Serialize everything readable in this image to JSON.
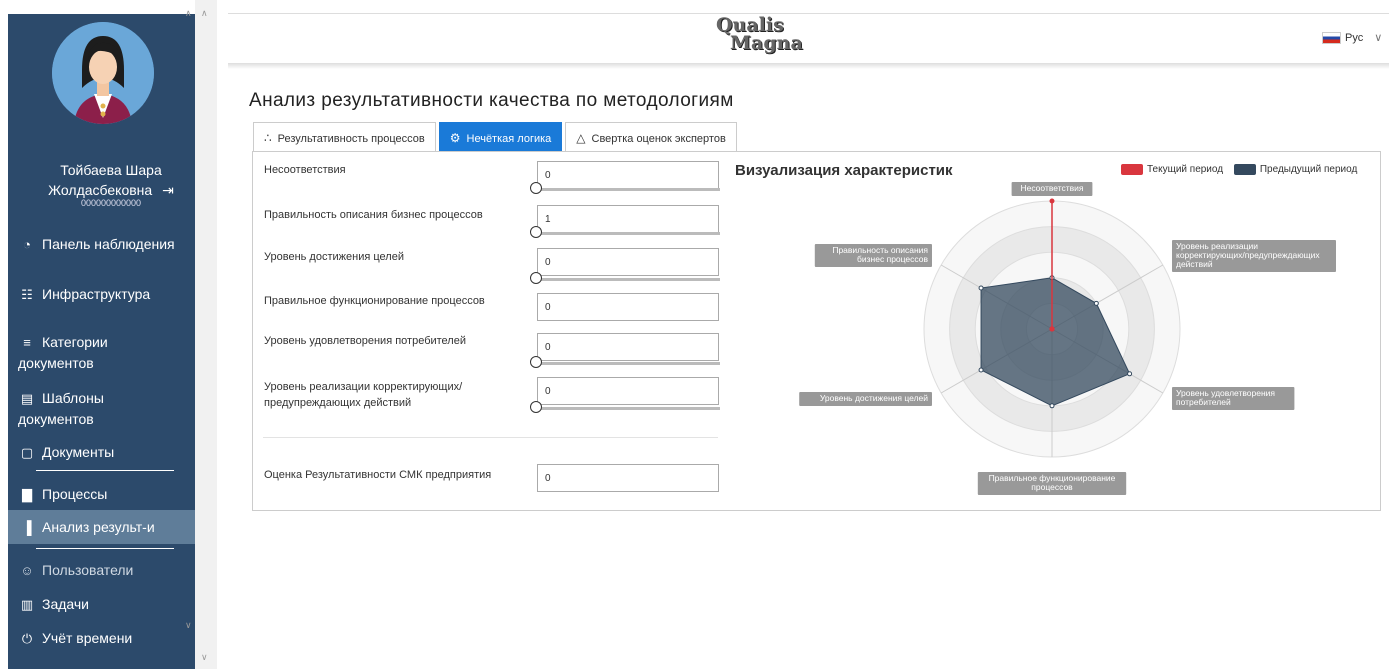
{
  "header": {
    "logo_line1": "Qualis",
    "logo_line2": "Magna",
    "lang": "Рус"
  },
  "sidebar": {
    "user_name": "Тойбаева Шара Жолдасбековна",
    "user_id": "000000000000",
    "items": [
      {
        "label": "Панель наблюдения",
        "icon": "dashboard-icon"
      },
      {
        "label": "Инфраструктура",
        "icon": "hierarchy-icon"
      },
      {
        "label": "Категории документов",
        "icon": "list-icon"
      },
      {
        "label": "Шаблоны документов",
        "icon": "file-icon"
      },
      {
        "label": "Документы",
        "icon": "square-icon"
      },
      {
        "label": "Процессы",
        "icon": "bar-chart-icon"
      },
      {
        "label": "Анализ результ-и",
        "icon": "analysis-chart-icon"
      },
      {
        "label": "Пользователи",
        "icon": "users-icon"
      },
      {
        "label": "Задачи",
        "icon": "clipboard-icon"
      },
      {
        "label": "Учёт времени",
        "icon": "power-clock-icon"
      }
    ]
  },
  "main": {
    "title": "Анализ результативности качества по методологиям",
    "tabs": [
      {
        "label": "Результативность процессов",
        "icon": "scatter-icon",
        "active": false
      },
      {
        "label": "Нечёткая логика",
        "icon": "gears-icon",
        "active": true
      },
      {
        "label": "Свертка оценок экспертов",
        "icon": "flask-icon",
        "active": false
      }
    ],
    "fields": [
      {
        "label": "Несоответствия",
        "value": "0",
        "slider": 0
      },
      {
        "label": "Правильность описания бизнес процессов",
        "value": "1",
        "slider": 0
      },
      {
        "label": "Уровень достижения целей",
        "value": "0",
        "slider": 0
      },
      {
        "label": "Правильное функционирование процессов",
        "value": "0"
      },
      {
        "label": "Уровень удовлетворения потребителей",
        "value": "0",
        "slider": 0
      },
      {
        "label": "Уровень реализации корректирующих/ предупреждающих действий",
        "value": "0",
        "slider": 0
      }
    ],
    "total_label": "Оценка Результативности СМК предприятия",
    "total_value": "0"
  },
  "chart_data": {
    "type": "radar",
    "title": "Визуализация характеристик",
    "axes": [
      "Несоответствия",
      "Уровень реализации корректирующих/предупреждающих действий",
      "Уровень удовлетворения потребителей",
      "Правильное функционирование процессов",
      "Уровень достижения целей",
      "Правильность описания бизнес процессов"
    ],
    "rmax": 5,
    "series": [
      {
        "name": "Текущий период",
        "color": "#d9363e",
        "values": [
          5,
          0,
          0,
          0,
          0,
          0
        ]
      },
      {
        "name": "Предыдущий период",
        "color": "#34495e",
        "values": [
          2,
          2,
          3.5,
          3,
          3.2,
          3.2
        ]
      }
    ],
    "legend_position": "top-right"
  }
}
